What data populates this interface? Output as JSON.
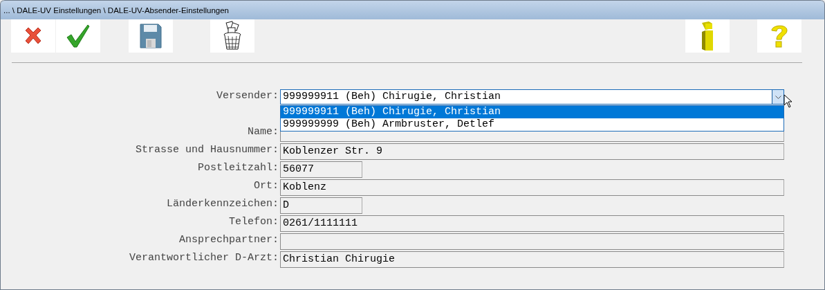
{
  "window": {
    "title": "... \\ DALE-UV Einstellungen \\ DALE-UV-Absender-Einstellungen"
  },
  "toolbar_left": [
    {
      "kind": "cancel"
    },
    {
      "kind": "confirm"
    },
    {
      "kind": "save"
    },
    {
      "kind": "delete"
    }
  ],
  "toolbar_right": [
    {
      "kind": "info"
    },
    {
      "kind": "help"
    }
  ],
  "sender": {
    "label": "Versender:",
    "value": "999999911 (Beh) Chirugie, Christian",
    "expanded": true,
    "options": [
      {
        "text": "999999911 (Beh) Chirugie, Christian",
        "selected": true
      },
      {
        "text": "999999999 (Beh) Armbruster, Detlef",
        "selected": false
      }
    ]
  },
  "fields": [
    {
      "label": "Name:",
      "kind": "wide"
    },
    {
      "label": "Strasse und Hausnummer:",
      "value": "Koblenzer Str. 9",
      "kind": "wide"
    },
    {
      "label": "Postleitzahl:",
      "value": "56077",
      "kind": "short"
    },
    {
      "label": "Ort:",
      "value": "Koblenz",
      "kind": "wide"
    },
    {
      "label": "Länderkennzeichen:",
      "value": "D",
      "kind": "short"
    },
    {
      "label": "Telefon:",
      "value": "0261/1111111",
      "kind": "wide"
    },
    {
      "label": "Ansprechpartner:",
      "kind": "wide"
    },
    {
      "label": "Verantwortlicher D-Arzt:",
      "value": "Christian Chirugie",
      "kind": "wide"
    }
  ]
}
